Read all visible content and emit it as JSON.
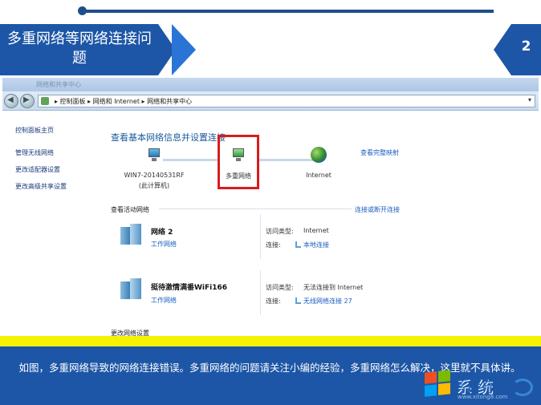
{
  "slide": {
    "title": "多重网络等网络连接问题",
    "page_number": "2",
    "caption": "如图，多重网络导致的网络连接错误。多重网络的问题请关注小编的经验，多重网络怎么解决，这里就不具体讲。"
  },
  "window": {
    "title": "网络和共享中心",
    "breadcrumb": "▸ 控制面板 ▸ 网络和 Internet ▸ 网络和共享中心"
  },
  "sidebar": {
    "items": [
      {
        "label": "控制面板主页"
      },
      {
        "label": "管理无线网络"
      },
      {
        "label": "更改适配器设置"
      },
      {
        "label": "更改高级共享设置"
      }
    ]
  },
  "main": {
    "heading": "查看基本网络信息并设置连接",
    "full_map_link": "查看完整映射",
    "nodes": [
      {
        "name": "WIN7-20140531RF",
        "sub": "(此计算机)"
      },
      {
        "name": "多重网络"
      },
      {
        "name": "Internet"
      }
    ],
    "active_title": "查看活动网络",
    "connect_link": "连接或断开连接",
    "networks": [
      {
        "name": "网络  2",
        "type": "工作网络",
        "access_label": "访问类型:",
        "access_value": "Internet",
        "conn_label": "连接:",
        "conn_value": "本地连接"
      },
      {
        "name": "挺待激情满番WiFi166",
        "type": "工作网络",
        "access_label": "访问类型:",
        "access_value": "无法连接到 Internet",
        "conn_label": "连接:",
        "conn_value": "无线网络连接 27"
      }
    ],
    "change_settings_cut": "更改网络设置"
  },
  "watermark": {
    "text": "系统",
    "url": "www.xitong8.com"
  }
}
